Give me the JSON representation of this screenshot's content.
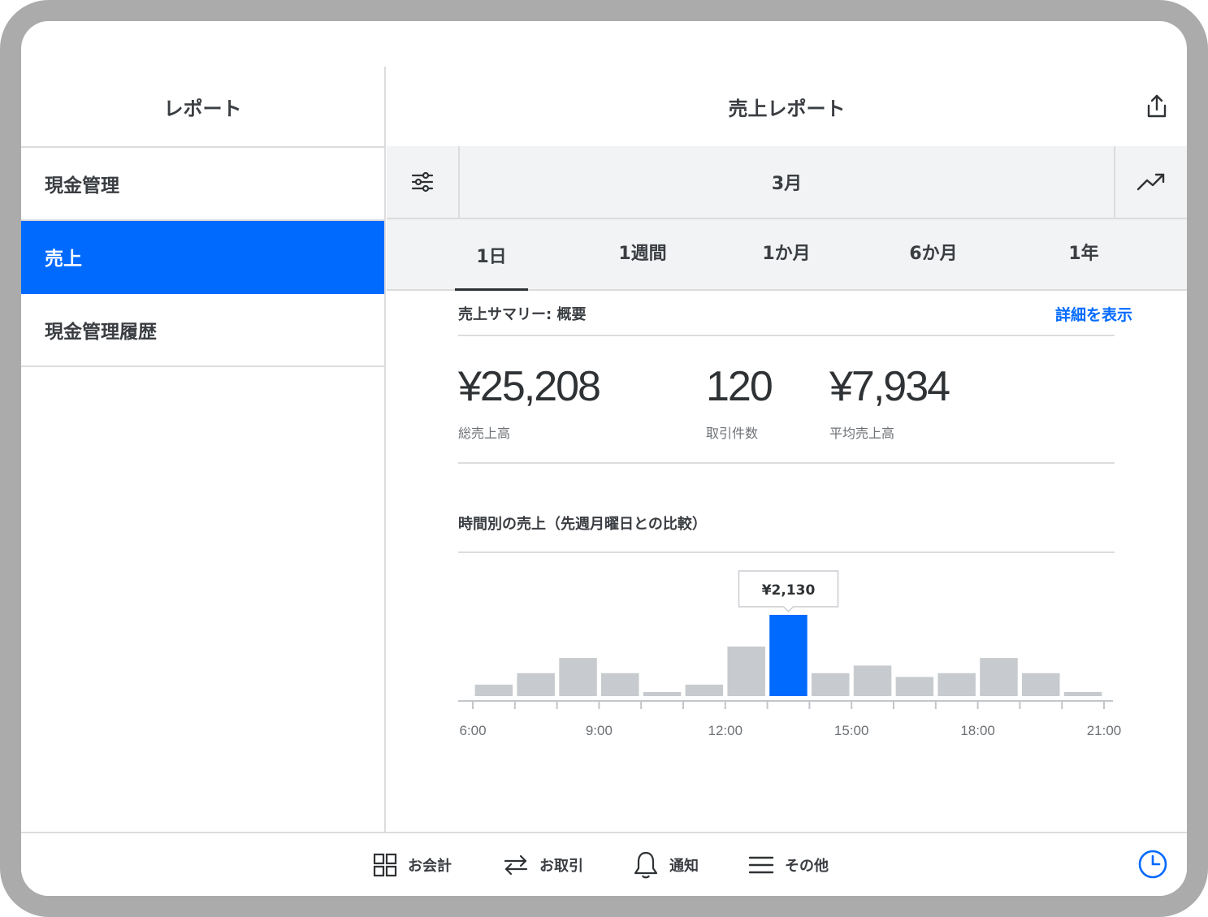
{
  "sidebar": {
    "title": "レポート",
    "items": [
      {
        "label": "現金管理",
        "active": false
      },
      {
        "label": "売上",
        "active": true
      },
      {
        "label": "現金管理履歴",
        "active": false
      }
    ]
  },
  "header": {
    "title": "売上レポート",
    "share_icon": "share-icon"
  },
  "date_bar": {
    "label": "3月",
    "filter_icon": "sliders-icon",
    "trend_icon": "trend-up-icon"
  },
  "period_tabs": [
    {
      "label": "1日",
      "active": true
    },
    {
      "label": "1週間",
      "active": false
    },
    {
      "label": "1か月",
      "active": false
    },
    {
      "label": "6か月",
      "active": false
    },
    {
      "label": "1年",
      "active": false
    }
  ],
  "summary": {
    "title": "売上サマリー: 概要",
    "detail_link": "詳細を表示",
    "metrics": [
      {
        "value": "¥25,208",
        "label": "総売上高"
      },
      {
        "value": "120",
        "label": "取引件数"
      },
      {
        "value": "¥7,934",
        "label": "平均売上高"
      }
    ]
  },
  "chart_title": "時間別の売上（先週月曜日との比較）",
  "chart_data": {
    "type": "bar",
    "title": "時間別の売上（先週月曜日との比較）",
    "categories": [
      "6:00",
      "7:00",
      "8:00",
      "9:00",
      "10:00",
      "11:00",
      "12:00",
      "13:00",
      "14:00",
      "15:00",
      "16:00",
      "17:00",
      "18:00",
      "19:00",
      "20:00"
    ],
    "values": [
      300,
      600,
      1000,
      600,
      100,
      300,
      1300,
      2130,
      600,
      800,
      500,
      600,
      1000,
      600,
      100
    ],
    "highlight_index": 7,
    "tooltip": "¥2,130",
    "tick_labels": [
      "6:00",
      "9:00",
      "12:00",
      "15:00",
      "18:00",
      "21:00"
    ],
    "xlim": [
      "6:00",
      "21:00"
    ],
    "ylim": [
      0,
      2130
    ],
    "colors": {
      "bar": "#c7cace",
      "highlight": "#006aff"
    }
  },
  "bottom_nav": {
    "items": [
      {
        "label": "お会計",
        "icon": "grid-icon"
      },
      {
        "label": "お取引",
        "icon": "transfer-arrows-icon"
      },
      {
        "label": "通知",
        "icon": "bell-icon"
      },
      {
        "label": "その他",
        "icon": "menu-icon"
      }
    ],
    "clock_icon": "clock-icon"
  },
  "colors": {
    "accent": "#006aff",
    "text": "#3a3d41",
    "divider": "#dcdcdc",
    "toolbar_bg": "#f2f3f4"
  }
}
